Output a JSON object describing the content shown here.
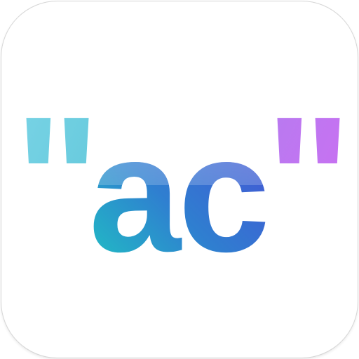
{
  "app_icon": {
    "logo": {
      "open_quote": "\"",
      "text": "ac",
      "close_quote": "\""
    },
    "colors": {
      "tile_background": "#ffffff",
      "gradient_teal": "#1ec8c2",
      "gradient_blue": "#2f7fd0",
      "gradient_indigo": "#4a4ad6",
      "gradient_violet": "#b57cf0",
      "quote_left": "#6ecfe0",
      "quote_right": "#c772f2"
    }
  }
}
